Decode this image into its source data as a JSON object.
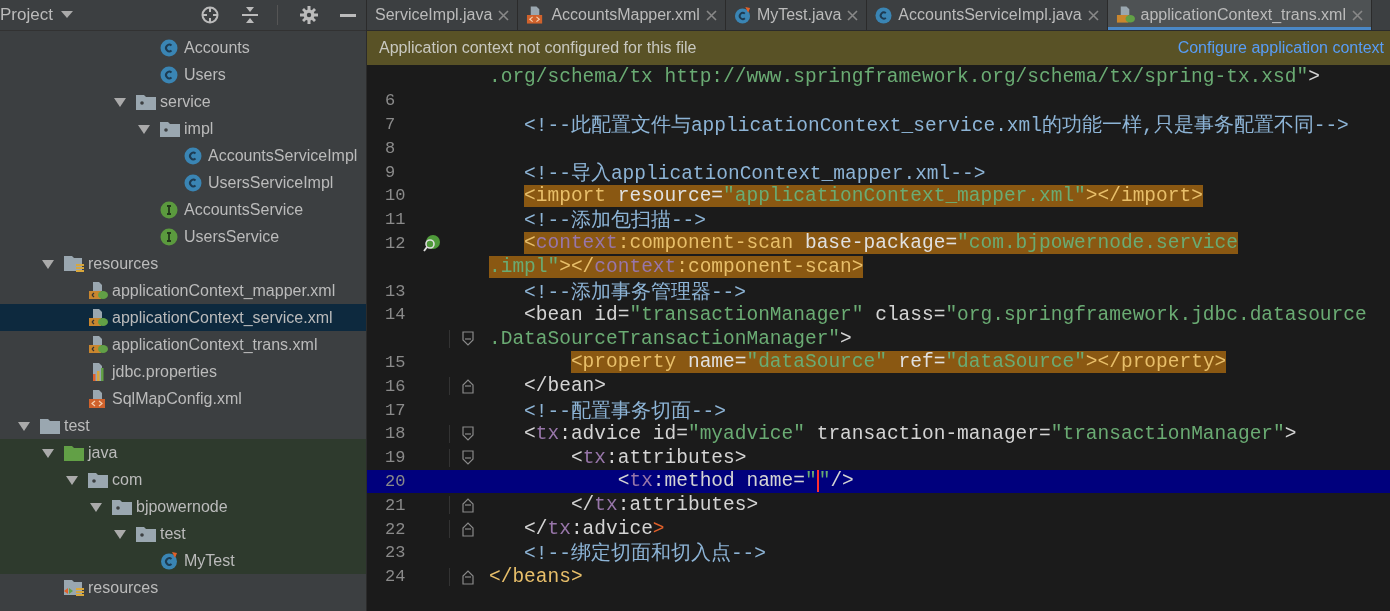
{
  "project": {
    "title": "Project",
    "tree": [
      {
        "children": [
          {
            "children": [
              {
                "children": [
                  {
                    "children": [
                      {
                        "children": [
                          {
                            "label": "Accounts",
                            "kind": "class",
                            "selected": false
                          },
                          {
                            "label": "Users",
                            "kind": "class",
                            "selected": false
                          }
                        ]
                      },
                      {
                        "label": "service",
                        "kind": "package",
                        "expanded": true,
                        "selected": false,
                        "children": [
                          {
                            "label": "impl",
                            "kind": "package",
                            "expanded": true,
                            "selected": false,
                            "children": [
                              {
                                "label": "AccountsServiceImpl",
                                "kind": "class",
                                "selected": false
                              },
                              {
                                "label": "UsersServiceImpl",
                                "kind": "class",
                                "selected": false
                              }
                            ]
                          },
                          {
                            "label": "AccountsService",
                            "kind": "interface",
                            "selected": false
                          },
                          {
                            "label": "UsersService",
                            "kind": "interface",
                            "selected": false
                          }
                        ]
                      }
                    ]
                  }
                ]
              }
            ]
          },
          {
            "label": "resources",
            "kind": "resources",
            "expanded": true,
            "selected": false,
            "children": [
              {
                "label": "applicationContext_mapper.xml",
                "kind": "springxml",
                "selected": false
              },
              {
                "label": "applicationContext_service.xml",
                "kind": "springxml",
                "selected": true
              },
              {
                "label": "applicationContext_trans.xml",
                "kind": "springxml",
                "selected": false
              },
              {
                "label": "jdbc.properties",
                "kind": "properties",
                "selected": false
              },
              {
                "label": "SqlMapConfig.xml",
                "kind": "xml",
                "selected": false
              }
            ]
          }
        ]
      },
      {
        "label": "test",
        "kind": "folder",
        "expanded": true,
        "selected": false,
        "children": [
          {
            "label": "java",
            "kind": "testroot",
            "expanded": true,
            "selected": false,
            "children": [
              {
                "label": "com",
                "kind": "package",
                "expanded": true,
                "selected": false,
                "children": [
                  {
                    "label": "bjpowernode",
                    "kind": "package",
                    "expanded": true,
                    "selected": false,
                    "children": [
                      {
                        "label": "test",
                        "kind": "package",
                        "expanded": true,
                        "selected": false,
                        "children": [
                          {
                            "label": "MyTest",
                            "kind": "testclass",
                            "selected": false
                          }
                        ]
                      }
                    ]
                  }
                ]
              }
            ]
          },
          {
            "label": "resources",
            "kind": "testresources",
            "selected": false
          }
        ]
      }
    ]
  },
  "tabs": [
    {
      "label": "ServiceImpl.java",
      "selected": false
    },
    {
      "label": "AccountsMapper.xml",
      "kind": "xml",
      "selected": false
    },
    {
      "label": "MyTest.java",
      "kind": "testclass",
      "selected": false
    },
    {
      "label": "AccountsServiceImpl.java",
      "kind": "class",
      "selected": false
    },
    {
      "label": "applicationContext_trans.xml",
      "kind": "springxml",
      "selected": true
    }
  ],
  "banner": {
    "message": "Application context not configured for this file",
    "link": "Configure application context"
  },
  "code": [
    {
      "tokens": [
        {
          "t": ".org/schema/tx http://www.springframework.org/schema/tx/spring-tx.xsd\"",
          "kind": "str"
        },
        {
          "t": ">",
          "kind": "tag"
        }
      ]
    },
    {
      "number": "6"
    },
    {
      "number": "7",
      "tokens": [
        {
          "t": "   <!--此配置文件与applicationContext_service.xml的功能一样,只是事务配置不同-->",
          "kind": "cm"
        }
      ]
    },
    {
      "number": "8"
    },
    {
      "number": "9",
      "tokens": [
        {
          "t": "   <!--导入applicationContext_mapper.xml-->",
          "kind": "cm"
        }
      ]
    },
    {
      "number": "10",
      "highlight": true,
      "tokens": [
        {
          "t": "   <import",
          "kind": "tag"
        },
        {
          "t": " resource=",
          "kind": "attr"
        },
        {
          "t": "\"applicationContext_mapper.xml\"",
          "kind": "str"
        },
        {
          "t": "></import>",
          "kind": "tag"
        }
      ]
    },
    {
      "number": "11",
      "tokens": [
        {
          "t": "   <!--添加包扫描-->",
          "kind": "cm"
        }
      ]
    },
    {
      "number": "12",
      "highlight": true,
      "gutter_marker": true,
      "tokens": [
        {
          "t": "   <",
          "kind": "tag"
        },
        {
          "t": "context",
          "kind": "ns"
        },
        {
          "t": ":component-scan",
          "kind": "tag"
        },
        {
          "t": " base-package=",
          "kind": "attr"
        },
        {
          "t": "\"com.bjpowernode.service",
          "kind": "str"
        }
      ]
    },
    {
      "highlight": true,
      "tokens": [
        {
          "t": ".impl\"",
          "kind": "str"
        },
        {
          "t": "></",
          "kind": "tag"
        },
        {
          "t": "context",
          "kind": "ns"
        },
        {
          "t": ":component-scan>",
          "kind": "tag"
        }
      ]
    },
    {
      "number": "13",
      "tokens": [
        {
          "t": "   <!--添加事务管理器-->",
          "kind": "cm"
        }
      ]
    },
    {
      "number": "14",
      "tokens": [
        {
          "t": "   <bean",
          "kind": "tag"
        },
        {
          "t": " id=",
          "kind": "attr"
        },
        {
          "t": "\"transactionManager\"",
          "kind": "str"
        },
        {
          "t": " class=",
          "kind": "attr"
        },
        {
          "t": "\"org.springframework.jdbc.datasource",
          "kind": "str"
        }
      ]
    },
    {
      "fold": {
        "kind": "open"
      },
      "tokens": [
        {
          "t": ".DataSourceTransactionManager\"",
          "kind": "str"
        },
        {
          "t": ">",
          "kind": "tag"
        }
      ]
    },
    {
      "number": "15",
      "highlight": true,
      "tokens": [
        {
          "t": "       <property",
          "kind": "tag"
        },
        {
          "t": " name=",
          "kind": "attr"
        },
        {
          "t": "\"dataSource\"",
          "kind": "str"
        },
        {
          "t": " ref=",
          "kind": "attr"
        },
        {
          "t": "\"dataSource\"",
          "kind": "str"
        },
        {
          "t": "></property>",
          "kind": "tag"
        }
      ]
    },
    {
      "number": "16",
      "fold": {
        "kind": "close"
      },
      "tokens": [
        {
          "t": "   </bean>",
          "kind": "tag"
        }
      ]
    },
    {
      "number": "17",
      "tokens": [
        {
          "t": "   <!--配置事务切面-->",
          "kind": "cm"
        }
      ]
    },
    {
      "number": "18",
      "fold": {
        "kind": "open"
      },
      "tokens": [
        {
          "t": "   <",
          "kind": "tag"
        },
        {
          "t": "tx",
          "kind": "ns"
        },
        {
          "t": ":advice",
          "kind": "tag"
        },
        {
          "t": " id=",
          "kind": "attr"
        },
        {
          "t": "\"myadvice\"",
          "kind": "str"
        },
        {
          "t": " transaction-manager=",
          "kind": "attr"
        },
        {
          "t": "\"transactionManager\"",
          "kind": "str"
        },
        {
          "t": ">",
          "kind": "tag"
        }
      ]
    },
    {
      "number": "19",
      "fold": {
        "kind": "open"
      },
      "tokens": [
        {
          "t": "       <",
          "kind": "tag"
        },
        {
          "t": "tx",
          "kind": "ns"
        },
        {
          "t": ":attributes>",
          "kind": "tag"
        }
      ]
    },
    {
      "number": "20",
      "current": true,
      "tokens": [
        {
          "t": "           <",
          "kind": "tag"
        },
        {
          "t": "tx",
          "kind": "ns"
        },
        {
          "t": ":method",
          "kind": "tag"
        },
        {
          "t": " name=",
          "kind": "attr"
        },
        {
          "t": "\"",
          "kind": "str",
          "caret_after": true
        },
        {
          "t": "\"",
          "kind": "str"
        },
        {
          "t": "/>",
          "kind": "tag"
        }
      ]
    },
    {
      "number": "21",
      "fold": {
        "kind": "close"
      },
      "tokens": [
        {
          "t": "       </",
          "kind": "tag"
        },
        {
          "t": "tx",
          "kind": "ns"
        },
        {
          "t": ":attributes>",
          "kind": "tag"
        }
      ]
    },
    {
      "number": "22",
      "fold": {
        "kind": "close"
      },
      "tokens": [
        {
          "t": "   </",
          "kind": "tag"
        },
        {
          "t": "tx",
          "kind": "ns"
        },
        {
          "t": ":advice",
          "kind": "tag"
        },
        {
          "t": ">",
          "kind": "mark"
        }
      ]
    },
    {
      "number": "23",
      "tokens": [
        {
          "t": "   <!--绑定切面和切入点-->",
          "kind": "cm"
        }
      ]
    },
    {
      "number": "24",
      "fold": {
        "kind": "close"
      },
      "tokens": [
        {
          "t": "</beans>",
          "kind": "match"
        }
      ]
    }
  ]
}
